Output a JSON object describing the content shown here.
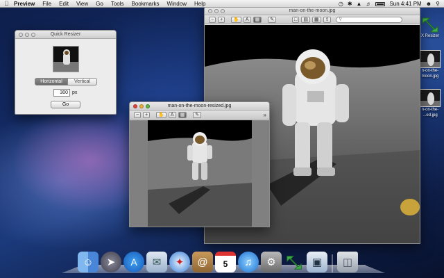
{
  "menubar": {
    "apple_icon": "apple-icon",
    "items": [
      "Preview",
      "File",
      "Edit",
      "View",
      "Go",
      "Tools",
      "Bookmarks",
      "Window",
      "Help"
    ],
    "clock": "Sun 4:41 PM"
  },
  "quick_resizer": {
    "title": "Quick Resizer",
    "orientation_options": [
      "Horizontal",
      "Vertical"
    ],
    "selected_orientation": "Horizontal",
    "size_value": "300",
    "size_unit": "px",
    "go_label": "Go"
  },
  "preview_large": {
    "title": "man-on-the-moon.jpg",
    "search_placeholder": ""
  },
  "preview_small": {
    "title": "man-on-the-moon-resized.jpg",
    "overflow_glyph": "»"
  },
  "desktop": {
    "icons": [
      {
        "label": "X Resizer"
      },
      {
        "label": "n-on-the-"
      },
      {
        "label": "moon.jpg"
      },
      {
        "label": "n-on-the-"
      },
      {
        "label": "...ed.jpg"
      }
    ]
  },
  "dock": {
    "items": [
      "finder-icon",
      "launchpad-icon",
      "app-store-icon",
      "mail-icon",
      "safari-icon",
      "address-book-icon",
      "ical-icon",
      "itunes-icon",
      "system-preferences-icon",
      "resizer-app-icon",
      "preview-icon",
      "trash-icon"
    ],
    "ical_date": "5"
  }
}
